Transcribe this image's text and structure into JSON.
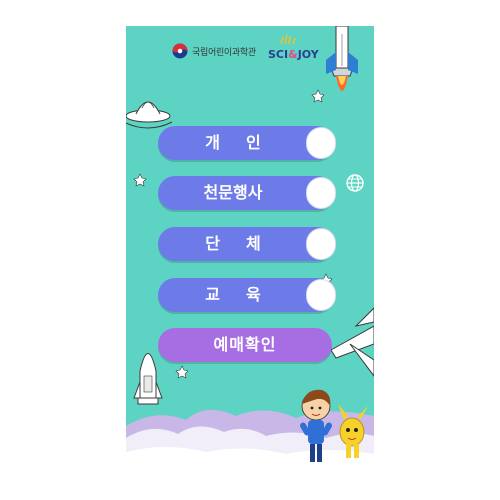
{
  "header": {
    "org_name": "국립어린이과학관",
    "brand_sci": "SCI",
    "brand_amp": "&",
    "brand_joy": "JOY"
  },
  "menu": {
    "individual": "개인",
    "astronomy_event": "천문행사",
    "group": "단체",
    "education": "교육",
    "booking_check": "예매확인"
  },
  "colors": {
    "background": "#5dd3c3",
    "button": "#6c7be8",
    "booking_button": "#a76ee3"
  }
}
